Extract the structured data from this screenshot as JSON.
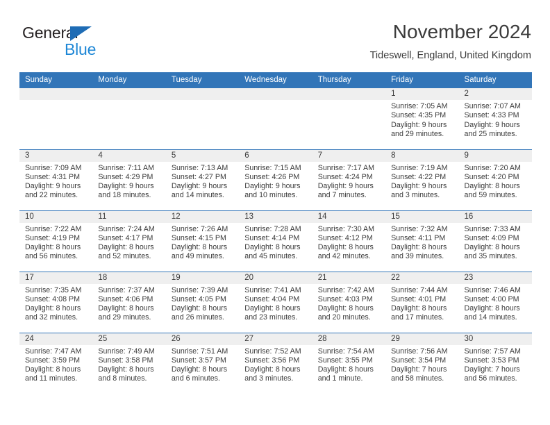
{
  "logo": {
    "word_one": "General",
    "word_two": "Blue",
    "triangle_color": "#1e6cb5",
    "blue_color": "#1e87d6"
  },
  "header": {
    "month_title": "November 2024",
    "location": "Tideswell, England, United Kingdom"
  },
  "theme": {
    "header_blue": "#3275b8",
    "day_band_gray": "#efefef",
    "text_color": "#3b3b3b"
  },
  "calendar": {
    "weekday_headers": [
      "Sunday",
      "Monday",
      "Tuesday",
      "Wednesday",
      "Thursday",
      "Friday",
      "Saturday"
    ],
    "weeks": [
      [
        {
          "day": "",
          "sunrise": "",
          "sunset": "",
          "daylight": "",
          "empty": true
        },
        {
          "day": "",
          "sunrise": "",
          "sunset": "",
          "daylight": "",
          "empty": true
        },
        {
          "day": "",
          "sunrise": "",
          "sunset": "",
          "daylight": "",
          "empty": true
        },
        {
          "day": "",
          "sunrise": "",
          "sunset": "",
          "daylight": "",
          "empty": true
        },
        {
          "day": "",
          "sunrise": "",
          "sunset": "",
          "daylight": "",
          "empty": true
        },
        {
          "day": "1",
          "sunrise": "Sunrise: 7:05 AM",
          "sunset": "Sunset: 4:35 PM",
          "daylight": "Daylight: 9 hours and 29 minutes."
        },
        {
          "day": "2",
          "sunrise": "Sunrise: 7:07 AM",
          "sunset": "Sunset: 4:33 PM",
          "daylight": "Daylight: 9 hours and 25 minutes."
        }
      ],
      [
        {
          "day": "3",
          "sunrise": "Sunrise: 7:09 AM",
          "sunset": "Sunset: 4:31 PM",
          "daylight": "Daylight: 9 hours and 22 minutes."
        },
        {
          "day": "4",
          "sunrise": "Sunrise: 7:11 AM",
          "sunset": "Sunset: 4:29 PM",
          "daylight": "Daylight: 9 hours and 18 minutes."
        },
        {
          "day": "5",
          "sunrise": "Sunrise: 7:13 AM",
          "sunset": "Sunset: 4:27 PM",
          "daylight": "Daylight: 9 hours and 14 minutes."
        },
        {
          "day": "6",
          "sunrise": "Sunrise: 7:15 AM",
          "sunset": "Sunset: 4:26 PM",
          "daylight": "Daylight: 9 hours and 10 minutes."
        },
        {
          "day": "7",
          "sunrise": "Sunrise: 7:17 AM",
          "sunset": "Sunset: 4:24 PM",
          "daylight": "Daylight: 9 hours and 7 minutes."
        },
        {
          "day": "8",
          "sunrise": "Sunrise: 7:19 AM",
          "sunset": "Sunset: 4:22 PM",
          "daylight": "Daylight: 9 hours and 3 minutes."
        },
        {
          "day": "9",
          "sunrise": "Sunrise: 7:20 AM",
          "sunset": "Sunset: 4:20 PM",
          "daylight": "Daylight: 8 hours and 59 minutes."
        }
      ],
      [
        {
          "day": "10",
          "sunrise": "Sunrise: 7:22 AM",
          "sunset": "Sunset: 4:19 PM",
          "daylight": "Daylight: 8 hours and 56 minutes."
        },
        {
          "day": "11",
          "sunrise": "Sunrise: 7:24 AM",
          "sunset": "Sunset: 4:17 PM",
          "daylight": "Daylight: 8 hours and 52 minutes."
        },
        {
          "day": "12",
          "sunrise": "Sunrise: 7:26 AM",
          "sunset": "Sunset: 4:15 PM",
          "daylight": "Daylight: 8 hours and 49 minutes."
        },
        {
          "day": "13",
          "sunrise": "Sunrise: 7:28 AM",
          "sunset": "Sunset: 4:14 PM",
          "daylight": "Daylight: 8 hours and 45 minutes."
        },
        {
          "day": "14",
          "sunrise": "Sunrise: 7:30 AM",
          "sunset": "Sunset: 4:12 PM",
          "daylight": "Daylight: 8 hours and 42 minutes."
        },
        {
          "day": "15",
          "sunrise": "Sunrise: 7:32 AM",
          "sunset": "Sunset: 4:11 PM",
          "daylight": "Daylight: 8 hours and 39 minutes."
        },
        {
          "day": "16",
          "sunrise": "Sunrise: 7:33 AM",
          "sunset": "Sunset: 4:09 PM",
          "daylight": "Daylight: 8 hours and 35 minutes."
        }
      ],
      [
        {
          "day": "17",
          "sunrise": "Sunrise: 7:35 AM",
          "sunset": "Sunset: 4:08 PM",
          "daylight": "Daylight: 8 hours and 32 minutes."
        },
        {
          "day": "18",
          "sunrise": "Sunrise: 7:37 AM",
          "sunset": "Sunset: 4:06 PM",
          "daylight": "Daylight: 8 hours and 29 minutes."
        },
        {
          "day": "19",
          "sunrise": "Sunrise: 7:39 AM",
          "sunset": "Sunset: 4:05 PM",
          "daylight": "Daylight: 8 hours and 26 minutes."
        },
        {
          "day": "20",
          "sunrise": "Sunrise: 7:41 AM",
          "sunset": "Sunset: 4:04 PM",
          "daylight": "Daylight: 8 hours and 23 minutes."
        },
        {
          "day": "21",
          "sunrise": "Sunrise: 7:42 AM",
          "sunset": "Sunset: 4:03 PM",
          "daylight": "Daylight: 8 hours and 20 minutes."
        },
        {
          "day": "22",
          "sunrise": "Sunrise: 7:44 AM",
          "sunset": "Sunset: 4:01 PM",
          "daylight": "Daylight: 8 hours and 17 minutes."
        },
        {
          "day": "23",
          "sunrise": "Sunrise: 7:46 AM",
          "sunset": "Sunset: 4:00 PM",
          "daylight": "Daylight: 8 hours and 14 minutes."
        }
      ],
      [
        {
          "day": "24",
          "sunrise": "Sunrise: 7:47 AM",
          "sunset": "Sunset: 3:59 PM",
          "daylight": "Daylight: 8 hours and 11 minutes."
        },
        {
          "day": "25",
          "sunrise": "Sunrise: 7:49 AM",
          "sunset": "Sunset: 3:58 PM",
          "daylight": "Daylight: 8 hours and 8 minutes."
        },
        {
          "day": "26",
          "sunrise": "Sunrise: 7:51 AM",
          "sunset": "Sunset: 3:57 PM",
          "daylight": "Daylight: 8 hours and 6 minutes."
        },
        {
          "day": "27",
          "sunrise": "Sunrise: 7:52 AM",
          "sunset": "Sunset: 3:56 PM",
          "daylight": "Daylight: 8 hours and 3 minutes."
        },
        {
          "day": "28",
          "sunrise": "Sunrise: 7:54 AM",
          "sunset": "Sunset: 3:55 PM",
          "daylight": "Daylight: 8 hours and 1 minute."
        },
        {
          "day": "29",
          "sunrise": "Sunrise: 7:56 AM",
          "sunset": "Sunset: 3:54 PM",
          "daylight": "Daylight: 7 hours and 58 minutes."
        },
        {
          "day": "30",
          "sunrise": "Sunrise: 7:57 AM",
          "sunset": "Sunset: 3:53 PM",
          "daylight": "Daylight: 7 hours and 56 minutes."
        }
      ]
    ]
  }
}
